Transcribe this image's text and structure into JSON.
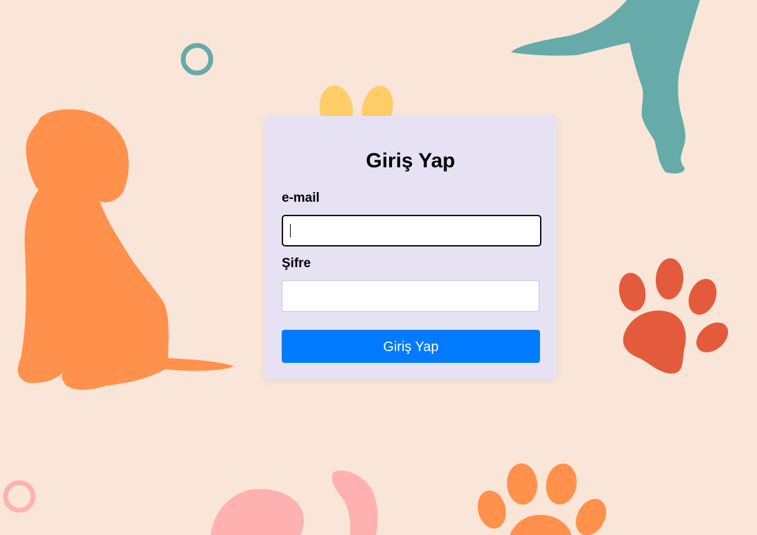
{
  "login": {
    "title": "Giriş Yap",
    "email_label": "e-mail",
    "email_value": "",
    "password_label": "Şifre",
    "password_value": "",
    "submit_label": "Giriş Yap"
  },
  "colors": {
    "background": "#fae6d8",
    "card": "#e6e2f3",
    "button": "#007bff",
    "dog_orange": "#ff914d",
    "dog_teal": "#66aaaa",
    "paw_red": "#e35b3c",
    "paw_orange": "#ff914d",
    "yellow": "#ffcd68",
    "pink": "#ffb1b1"
  },
  "decorations": {
    "icons": [
      "sitting-dog-icon",
      "walking-dog-icon",
      "paw-print-icon",
      "paw-print-icon",
      "ring-icon",
      "ring-icon",
      "ears-icon",
      "blob-icon"
    ]
  }
}
